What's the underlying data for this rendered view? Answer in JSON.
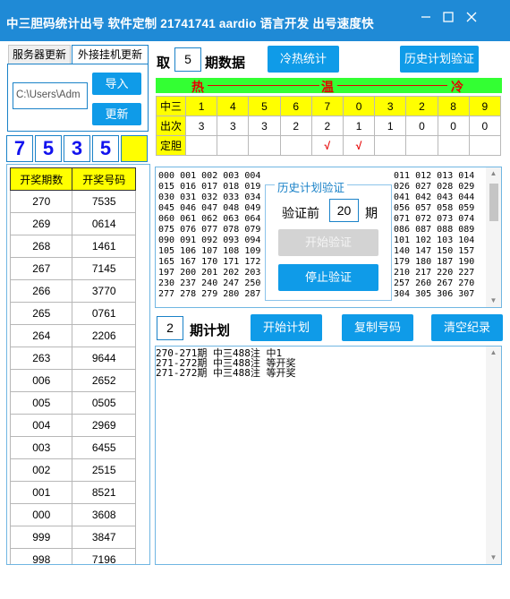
{
  "window": {
    "title": "中三胆码统计出号 软件定制 21741741 aardio 语言开发 出号速度快",
    "min_icon": "minimize-icon",
    "max_icon": "maximize-icon",
    "close_icon": "close-icon"
  },
  "tabs": [
    "服务器更新",
    "外接挂机更新"
  ],
  "left_panel": {
    "path_value": "C:\\Users\\Adm",
    "import_label": "导入",
    "update_label": "更新"
  },
  "digits": [
    "7",
    "5",
    "3",
    "5",
    ""
  ],
  "history": {
    "headers": [
      "开奖期数",
      "开奖号码"
    ],
    "rows": [
      [
        "270",
        "7535"
      ],
      [
        "269",
        "0614"
      ],
      [
        "268",
        "1461"
      ],
      [
        "267",
        "7145"
      ],
      [
        "266",
        "3770"
      ],
      [
        "265",
        "0761"
      ],
      [
        "264",
        "2206"
      ],
      [
        "263",
        "9644"
      ],
      [
        "006",
        "2652"
      ],
      [
        "005",
        "0505"
      ],
      [
        "004",
        "2969"
      ],
      [
        "003",
        "6455"
      ],
      [
        "002",
        "2515"
      ],
      [
        "001",
        "8521"
      ],
      [
        "000",
        "3608"
      ],
      [
        "999",
        "3847"
      ],
      [
        "998",
        "7196"
      ]
    ]
  },
  "top": {
    "take_label": "取",
    "take_value": "5",
    "period_label": "期数据",
    "hotcold_label": "冷热统计",
    "history_verify_label": "历史计划验证"
  },
  "heat_bar": {
    "hot": "热",
    "warm": "温",
    "cold": "冷",
    "line": "————————"
  },
  "stats": {
    "row_labels": [
      "中三",
      "出次",
      "定胆"
    ],
    "digits": [
      "1",
      "4",
      "5",
      "6",
      "7",
      "0",
      "3",
      "2",
      "8",
      "9"
    ],
    "counts": [
      "3",
      "3",
      "3",
      "2",
      "2",
      "1",
      "1",
      "0",
      "0",
      "0"
    ],
    "marks": [
      "",
      "",
      "",
      "",
      "√",
      "√",
      "",
      "",
      "",
      ""
    ]
  },
  "numbers_left": [
    "000 001 002 003 004",
    "015 016 017 018 019",
    "030 031 032 033 034",
    "045 046 047 048 049",
    "060 061 062 063 064",
    "075 076 077 078 079",
    "090 091 092 093 094",
    "105 106 107 108 109",
    "165 167 170 171 172",
    "197 200 201 202 203",
    "230 237 240 247 250",
    "277 278 279 280 287"
  ],
  "numbers_right": [
    "011 012 013 014",
    "026 027 028 029",
    "041 042 043 044",
    "056 057 058 059",
    "071 072 073 074",
    "086 087 088 089",
    "101 102 103 104",
    "140 147 150 157",
    "179 180 187 190",
    "210 217 220 227",
    "257 260 267 270",
    "304 305 306 307"
  ],
  "verify_dialog": {
    "title": "历史计划验证",
    "before_label": "验证前",
    "before_value": "20",
    "period_label": "期",
    "start_label": "开始验证",
    "stop_label": "停止验证"
  },
  "plan": {
    "value": "2",
    "label": "期计划",
    "start_plan_label": "开始计划",
    "copy_label": "复制号码",
    "clear_label": "清空纪录"
  },
  "log_lines": [
    "270-271期 中三488注 中1",
    "271-272期 中三488注 等开奖",
    "271-272期 中三488注 等开奖"
  ],
  "colors": {
    "accent": "#0f9be8",
    "titlebar": "#1f8ad6",
    "heat_bar": "#33ff33",
    "highlight": "#ffff00"
  }
}
